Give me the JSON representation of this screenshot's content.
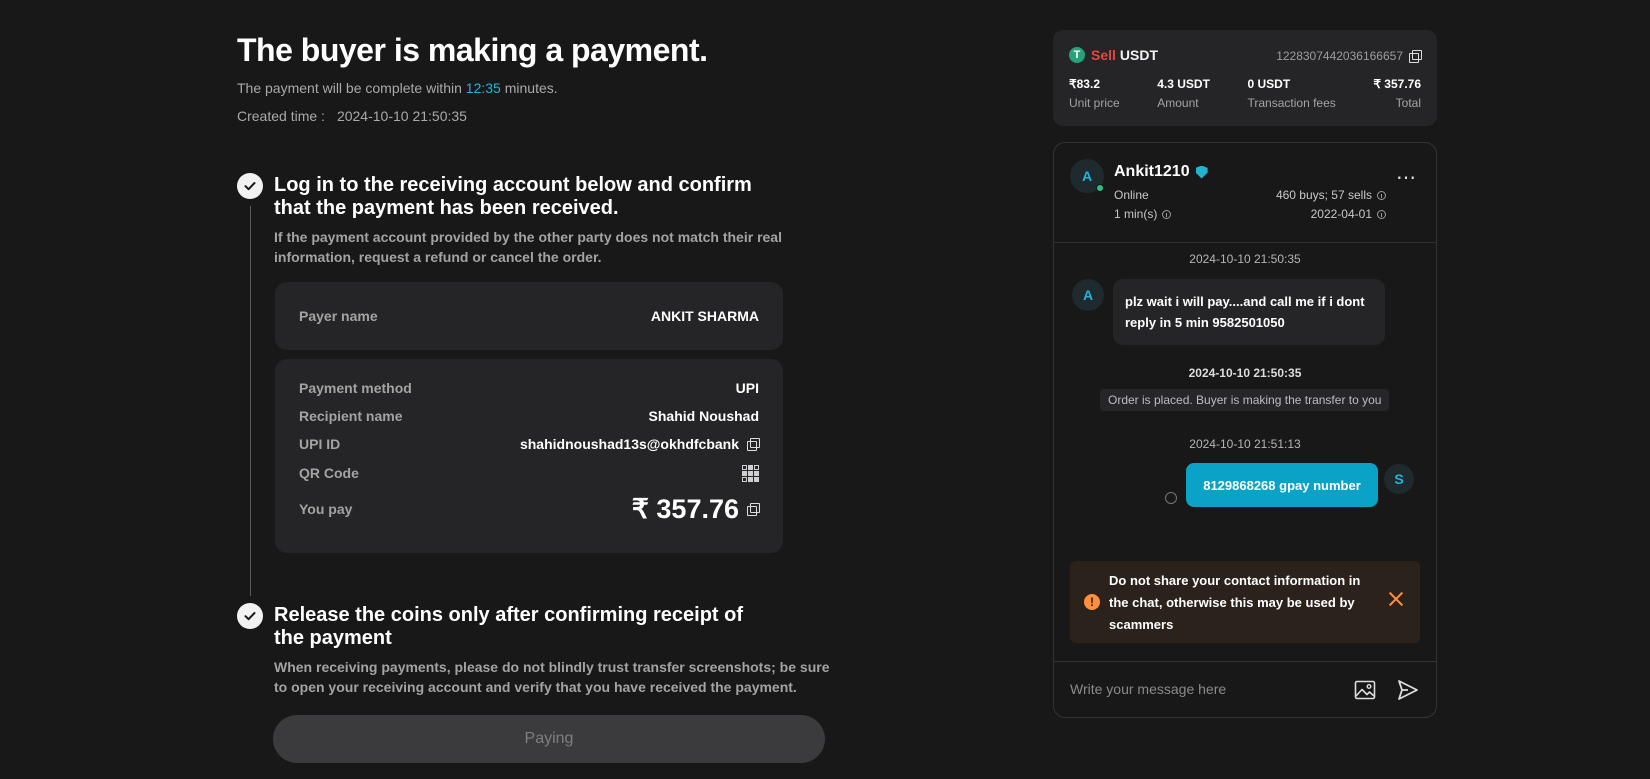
{
  "header": {
    "title": "The buyer is making a payment.",
    "sub_prefix": "The payment will be complete within",
    "timer": "12:35",
    "sub_suffix": "minutes.",
    "created_label": "Created time :",
    "created_value": "2024-10-10 21:50:35"
  },
  "step1": {
    "title": "Log in to the receiving account below and confirm that the payment has been received.",
    "desc": "If the payment account provided by the other party does not match their real information, request a refund or cancel the order.",
    "payer_label": "Payer name",
    "payer_value": "ANKIT SHARMA",
    "method_label": "Payment method",
    "method_value": "UPI",
    "recipient_label": "Recipient name",
    "recipient_value": "Shahid Noushad",
    "upi_label": "UPI ID",
    "upi_value": "shahidnoushad13s@okhdfcbank",
    "qr_label": "QR Code",
    "pay_label": "You pay",
    "pay_value": "₹ 357.76"
  },
  "step2": {
    "title": "Release the coins only after confirming receipt of the payment",
    "desc": "When receiving payments, please do not blindly trust transfer screenshots; be sure to open your receiving account and verify that you have received the payment.",
    "button": "Paying"
  },
  "order": {
    "side": "Sell",
    "asset": "USDT",
    "asset_icon": "tether-icon",
    "order_id": "1228307442036166657",
    "stats": [
      {
        "value": "₹83.2",
        "label": "Unit price"
      },
      {
        "value": "4.3 USDT",
        "label": "Amount"
      },
      {
        "value": "0 USDT",
        "label": "Transaction fees"
      },
      {
        "value": "₹ 357.76",
        "label": "Total"
      }
    ]
  },
  "chat": {
    "user": {
      "initial": "A",
      "name": "Ankit1210",
      "status": "Online",
      "response_time": "1 min(s)",
      "trades": "460 buys; 57 sells",
      "joined": "2022-04-01"
    },
    "messages": {
      "ts1": "2024-10-10 21:50:35",
      "msg1": "plz wait i will pay....and call me if i dont reply in 5 min 9582501050",
      "ts2": "2024-10-10 21:50:35",
      "system": "Order is placed. Buyer is making the transfer to you",
      "ts3": "2024-10-10 21:51:13",
      "msg2": "8129868268 gpay number",
      "self_initial": "S"
    },
    "warning": "Do not share your contact information in the chat, otherwise this may be used by scammers",
    "placeholder": "Write your message here"
  },
  "colors": {
    "accent": "#0aa3c7",
    "sell": "#e8453c",
    "warning": "#ff8f3e",
    "background": "#181818"
  }
}
